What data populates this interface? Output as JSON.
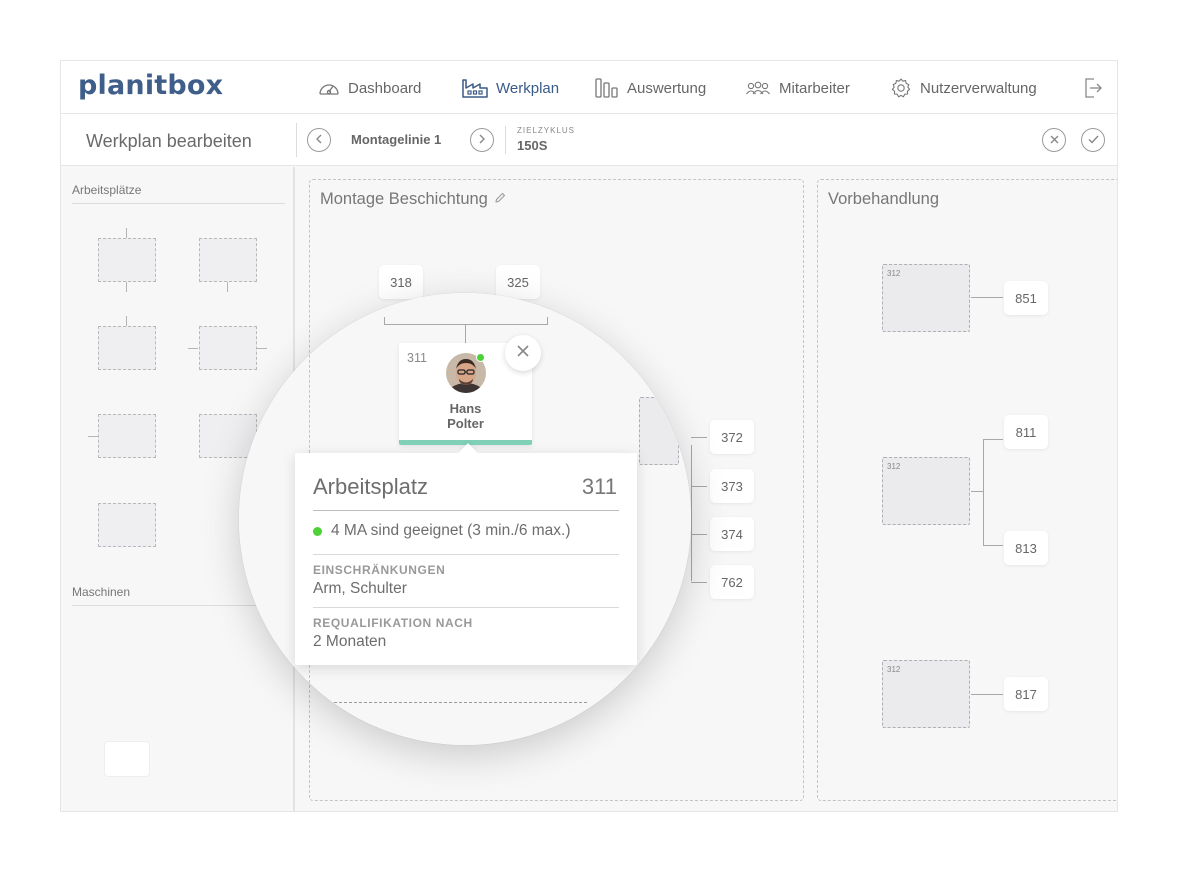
{
  "app": {
    "logo": "planitbox"
  },
  "nav": {
    "items": [
      {
        "label": "Dashboard",
        "icon": "gauge-icon"
      },
      {
        "label": "Werkplan",
        "icon": "factory-icon",
        "active": true
      },
      {
        "label": "Auswertung",
        "icon": "bar-chart-icon"
      },
      {
        "label": "Mitarbeiter",
        "icon": "people-icon"
      },
      {
        "label": "Nutzerverwaltung",
        "icon": "gear-icon"
      }
    ],
    "logout_icon": "logout-icon"
  },
  "subheader": {
    "title": "Werkplan bearbeiten",
    "line_name": "Montagelinie 1",
    "cycle_label": "ZIELZYKLUS",
    "cycle_value": "150S"
  },
  "sidebar": {
    "workstations_heading": "Arbeitsplätze",
    "machines_heading": "Maschinen"
  },
  "zones": [
    {
      "title": "Montage Beschichtung",
      "chips": [
        "318",
        "325",
        "372",
        "373",
        "374",
        "762"
      ]
    },
    {
      "title": "Vorbehandlung",
      "stations": [
        {
          "id": "312",
          "outputs": [
            "851"
          ]
        },
        {
          "id": "312",
          "outputs": [
            "811",
            "813"
          ]
        },
        {
          "id": "312",
          "outputs": [
            "817"
          ]
        }
      ]
    }
  ],
  "person_card": {
    "id": "311",
    "first_name": "Hans",
    "last_name": "Polter",
    "status_color": "#4cd137",
    "bar_color": "#7fd0b7"
  },
  "popover": {
    "title": "Arbeitsplatz",
    "id": "311",
    "suitability": "4 MA sind geeignet (3 min./6 max.)",
    "restrictions_label": "EINSCHRÄNKUNGEN",
    "restrictions_value": "Arm, Schulter",
    "requal_label": "REQUALIFIKATION NACH",
    "requal_value": "2 Monaten"
  },
  "colors": {
    "brand": "#3f5f8a",
    "online": "#4cd137",
    "accent_bar": "#7fd0b7"
  }
}
